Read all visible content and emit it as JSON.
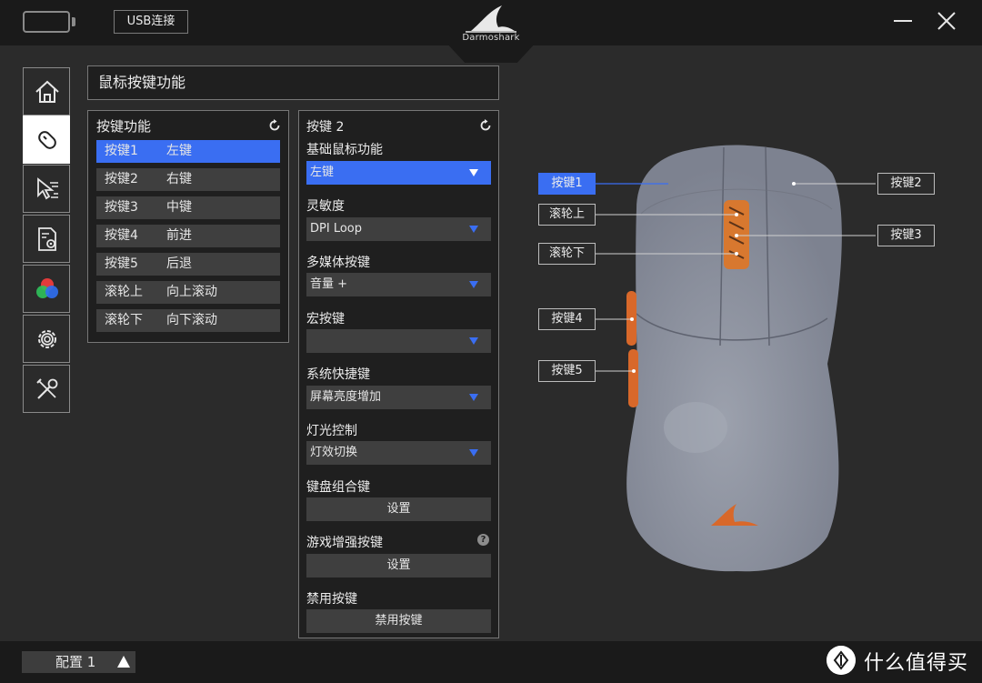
{
  "topbar": {
    "connection_label": "USB连接",
    "brand": "Darmoshark"
  },
  "sidebar": {
    "items": [
      {
        "name": "home",
        "icon": "home-icon",
        "active": false
      },
      {
        "name": "buttons",
        "icon": "mouse-icon",
        "active": true
      },
      {
        "name": "performance",
        "icon": "cursor-speed-icon",
        "active": false
      },
      {
        "name": "macro",
        "icon": "document-gear-icon",
        "active": false
      },
      {
        "name": "lighting",
        "icon": "rgb-icon",
        "active": false
      },
      {
        "name": "settings",
        "icon": "gear-icon",
        "active": false
      },
      {
        "name": "tools",
        "icon": "tools-icon",
        "active": false
      }
    ]
  },
  "header": {
    "title": "鼠标按键功能"
  },
  "button_functions": {
    "title": "按键功能",
    "rows": [
      {
        "key": "按键1",
        "value": "左键",
        "selected": true
      },
      {
        "key": "按键2",
        "value": "右键",
        "selected": false
      },
      {
        "key": "按键3",
        "value": "中键",
        "selected": false
      },
      {
        "key": "按键4",
        "value": "前进",
        "selected": false
      },
      {
        "key": "按键5",
        "value": "后退",
        "selected": false
      },
      {
        "key": "滚轮上",
        "value": "向上滚动",
        "selected": false
      },
      {
        "key": "滚轮下",
        "value": "向下滚动",
        "selected": false
      }
    ]
  },
  "settings": {
    "title": "按键 2",
    "basic_label": "基础鼠标功能",
    "basic_value": "左键",
    "sensitivity_label": "灵敏度",
    "sensitivity_value": "DPI Loop",
    "media_label": "多媒体按键",
    "media_value": "音量 +",
    "macro_label": "宏按键",
    "macro_value": "",
    "shortcut_label": "系统快捷键",
    "shortcut_value": "屏幕亮度增加",
    "light_label": "灯光控制",
    "light_value": "灯效切换",
    "combo_label": "键盘组合键",
    "combo_button": "设置",
    "game_label": "游戏增强按键",
    "game_help": "?",
    "game_button": "设置",
    "disable_label": "禁用按键",
    "disable_button": "禁用按键"
  },
  "mouse_tags": {
    "btn1": "按键1",
    "btn2": "按键2",
    "wheel_up": "滚轮上",
    "btn3": "按键3",
    "wheel_down": "滚轮下",
    "btn4": "按键4",
    "btn5": "按键5"
  },
  "footer": {
    "profile_label": "配置 1",
    "watermark": "什么值得买"
  },
  "colors": {
    "accent": "#3a6ef2",
    "background": "#2b2b2b",
    "bar": "#1a1a1a",
    "mouse_body": "#8a8f9c",
    "mouse_accent": "#e06a2a"
  }
}
